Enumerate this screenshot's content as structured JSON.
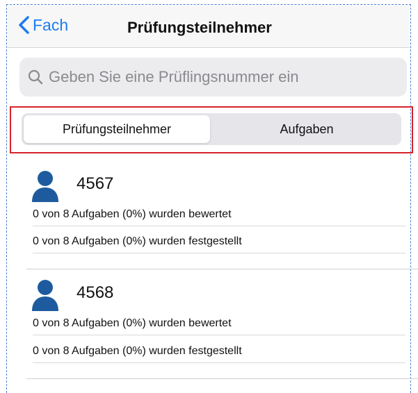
{
  "nav": {
    "back_label": "Fach",
    "title": "Prüfungsteilnehmer"
  },
  "search": {
    "placeholder": "Geben Sie eine Prüflingsnummer ein",
    "value": ""
  },
  "segments": [
    {
      "label": "Prüfungsteilnehmer",
      "selected": true
    },
    {
      "label": "Aufgaben",
      "selected": false
    }
  ],
  "participants": [
    {
      "id": "4567",
      "rated": "0 von 8 Aufgaben (0%) wurden bewertet",
      "fixed": "0 von 8 Aufgaben (0%) wurden festgestellt"
    },
    {
      "id": "4568",
      "rated": "0 von 8 Aufgaben (0%) wurden bewertet",
      "fixed": "0 von 8 Aufgaben (0%) wurden festgestellt"
    }
  ],
  "icons": {
    "back": "chevron-left-icon",
    "search": "search-icon",
    "participant": "person-icon"
  },
  "colors": {
    "accent": "#1a7cf2",
    "person": "#1e5b9e",
    "highlight_border": "#d8232a"
  }
}
